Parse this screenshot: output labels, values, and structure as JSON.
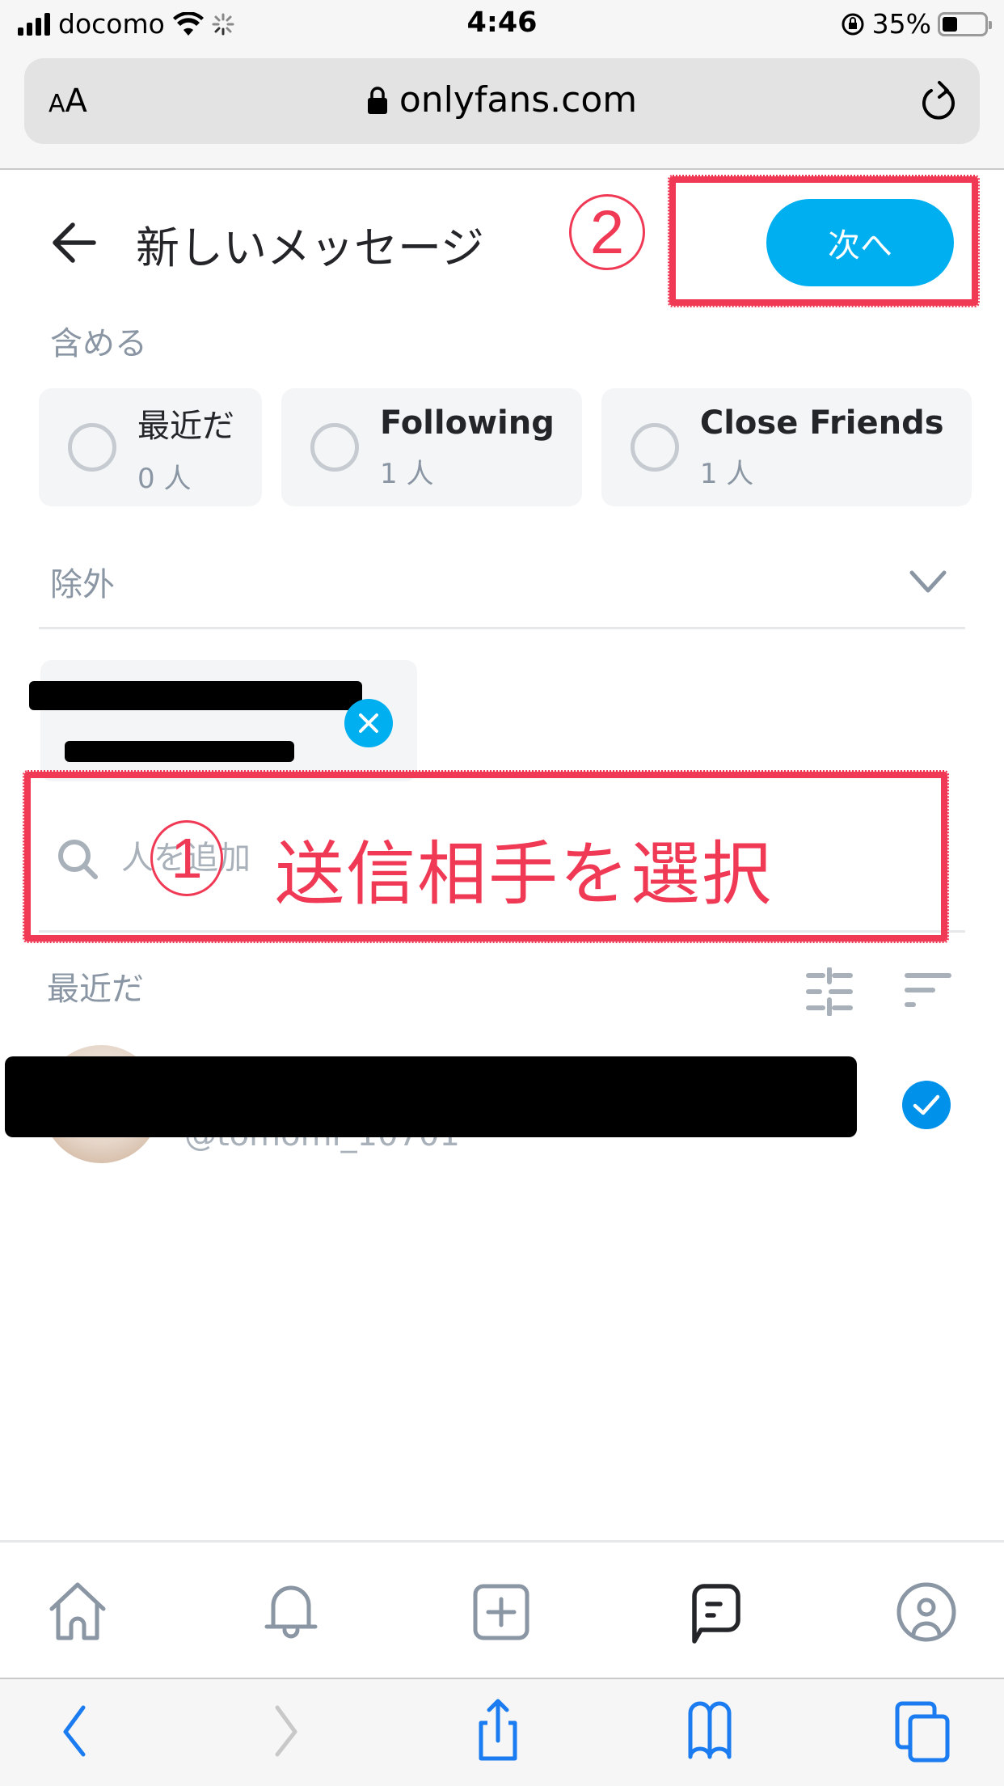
{
  "status_bar": {
    "carrier": "docomo",
    "time": "4:46",
    "battery_percent": "35%",
    "battery_level": 0.35
  },
  "browser": {
    "text_size_label_small": "A",
    "text_size_label_large": "A",
    "url": "onlyfans.com"
  },
  "header": {
    "title": "新しいメッセージ",
    "next_label": "次へ"
  },
  "include": {
    "label": "含める",
    "options": [
      {
        "name": "最近だ",
        "count": "0 人",
        "selected": false
      },
      {
        "name": "Following",
        "count": "1 人",
        "selected": false
      },
      {
        "name": "Close Friends",
        "count": "1 人",
        "selected": false
      }
    ]
  },
  "exclude": {
    "label": "除外"
  },
  "search": {
    "placeholder": "人を追加",
    "value": ""
  },
  "recent": {
    "label": "最近だ",
    "contacts": [
      {
        "handle": "@tomomi_10701",
        "selected": true
      }
    ]
  },
  "annotations": {
    "step1_number": "1",
    "step1_text": "送信相手を選択",
    "step2_number": "2",
    "color": "#f03a55"
  },
  "colors": {
    "accent": "#00aff0",
    "check": "#0091ea",
    "muted": "#8a96a3",
    "safari_blue": "#1a7cf0"
  },
  "tabs": [
    "home",
    "notifications",
    "create",
    "messages",
    "profile"
  ],
  "active_tab": "messages"
}
